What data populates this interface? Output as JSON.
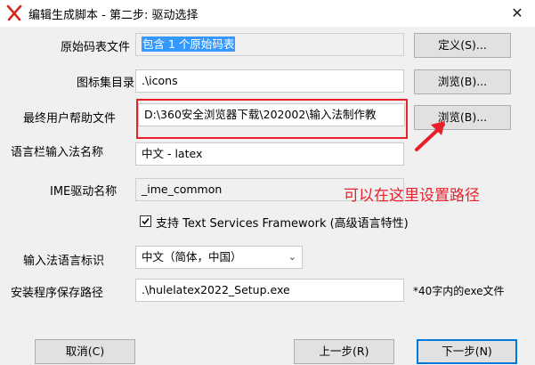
{
  "window": {
    "title": "编辑生成脚本 - 第二步: 驱动选择",
    "close_glyph": "✕"
  },
  "rows": {
    "source_table": {
      "label": "原始码表文件",
      "value": "包含 1 个原始码表",
      "button": "定义(S)..."
    },
    "icon_dir": {
      "label": "图标集目录",
      "value": ".\\icons",
      "button": "浏览(B)..."
    },
    "help_file": {
      "label": "最终用户帮助文件",
      "value": "D:\\360安全浏览器下载\\202002\\输入法制作教",
      "button": "浏览(B)..."
    },
    "langbar_name": {
      "label": "语言栏输入法名称",
      "value": "中文 - latex"
    },
    "ime_driver": {
      "label": "IME驱动名称",
      "value": "_ime_common"
    },
    "tsf": {
      "checked": true,
      "label": "支持 Text Services Framework (高级语言特性)"
    },
    "lang_id": {
      "label": "输入法语言标识",
      "value": "中文（简体，中国）"
    },
    "setup_path": {
      "label": "安装程序保存路径",
      "value": ".\\hulelatex2022_Setup.exe",
      "hint": "*40字内的exe文件"
    }
  },
  "annotation": {
    "text": "可以在这里设置路径",
    "color": "#e8202a"
  },
  "footer": {
    "cancel": "取消(C)",
    "prev": "上一步(R)",
    "next": "下一步(N)"
  }
}
